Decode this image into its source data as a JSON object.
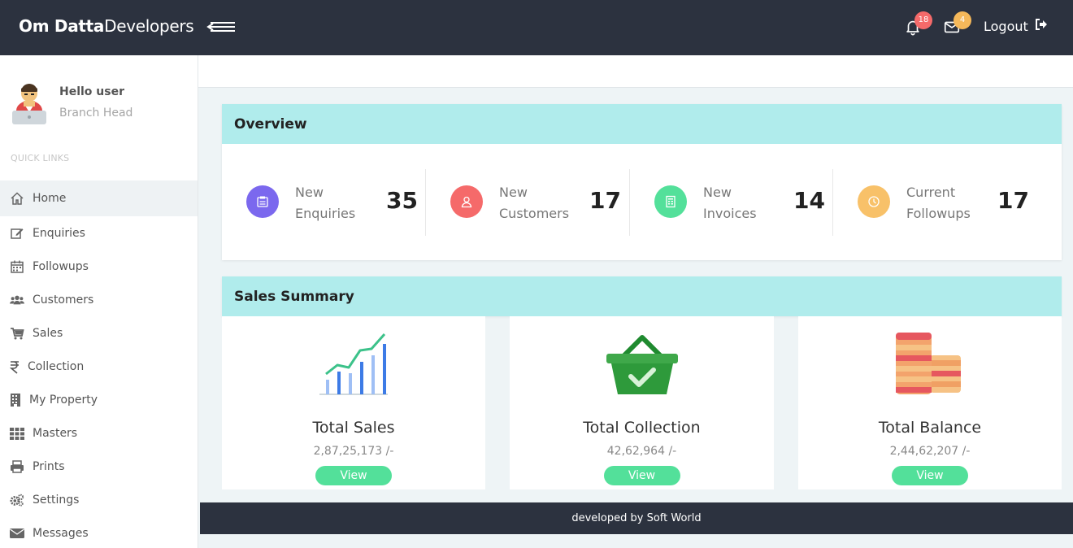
{
  "brand": {
    "bold": "Om Datta",
    "light": "Developers"
  },
  "header": {
    "notifications_count": "18",
    "messages_count": "4",
    "logout_label": "Logout"
  },
  "user": {
    "greeting": "Hello user",
    "role": "Branch Head"
  },
  "sidebar": {
    "section_title": "QUICK LINKS",
    "items": [
      {
        "label": "Home",
        "icon": "home-icon"
      },
      {
        "label": "Enquiries",
        "icon": "edit-icon"
      },
      {
        "label": "Followups",
        "icon": "calendar-icon"
      },
      {
        "label": "Customers",
        "icon": "users-icon"
      },
      {
        "label": "Sales",
        "icon": "cart-icon"
      },
      {
        "label": "Collection",
        "icon": "rupee-icon"
      },
      {
        "label": "My Property",
        "icon": "building-icon"
      },
      {
        "label": "Masters",
        "icon": "grid-icon"
      },
      {
        "label": "Prints",
        "icon": "print-icon"
      },
      {
        "label": "Settings",
        "icon": "cogs-icon"
      },
      {
        "label": "Messages",
        "icon": "envelope-icon"
      }
    ]
  },
  "overview": {
    "title": "Overview",
    "stats": [
      {
        "line1": "New",
        "line2": "Enquiries",
        "value": "35",
        "color": "#7b68ee"
      },
      {
        "line1": "New",
        "line2": "Customers",
        "value": "17",
        "color": "#f56a6a"
      },
      {
        "line1": "New",
        "line2": "Invoices",
        "value": "14",
        "color": "#53e09a"
      },
      {
        "line1": "Current",
        "line2": "Followups",
        "value": "17",
        "color": "#f8c169"
      }
    ]
  },
  "sales_summary": {
    "title": "Sales Summary",
    "boxes": [
      {
        "title": "Total Sales",
        "amount": "2,87,25,173 /-",
        "button": "View"
      },
      {
        "title": "Total Collection",
        "amount": "42,62,964 /-",
        "button": "View"
      },
      {
        "title": "Total Balance",
        "amount": "2,44,62,207 /-",
        "button": "View"
      }
    ]
  },
  "footer": {
    "text": "developed by Soft World"
  },
  "colors": {
    "header_bg": "#2c323f",
    "card_head_bg": "#b0ecec",
    "view_button": "#53e09a"
  }
}
